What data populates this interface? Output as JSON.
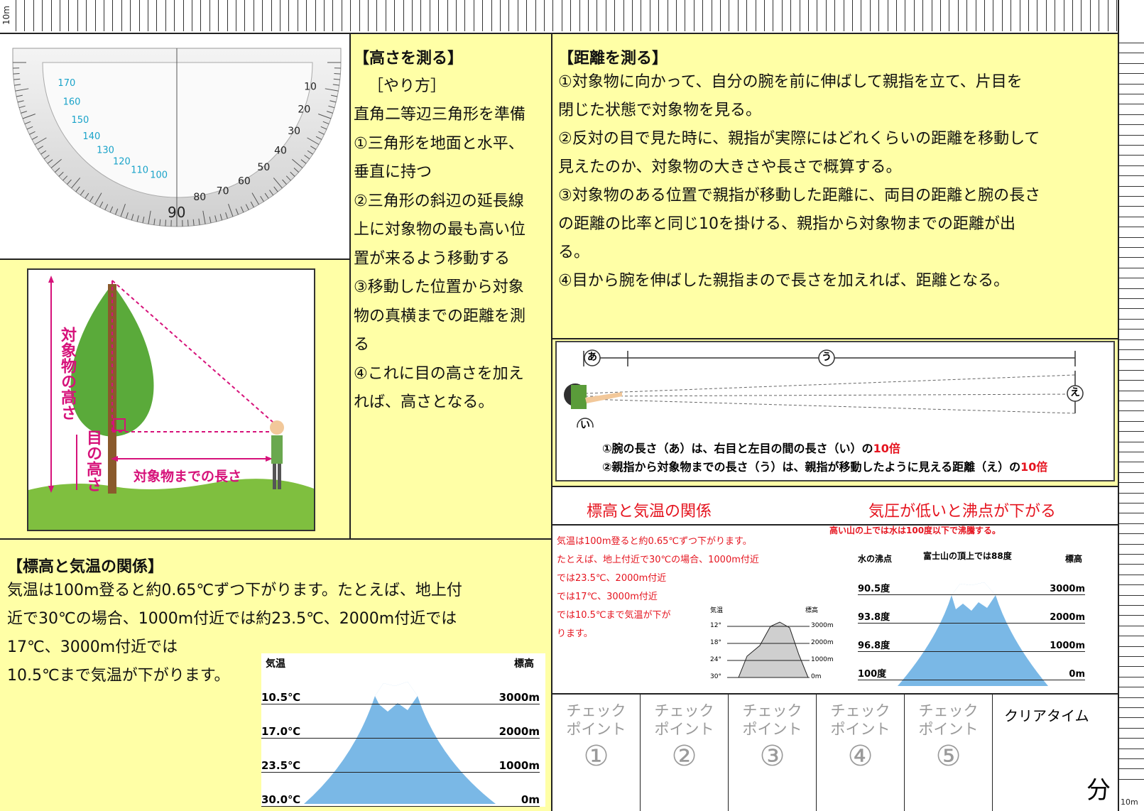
{
  "ruler": {
    "top_label": "10m",
    "corner_label": "10m"
  },
  "protractor": {
    "center_label": "90",
    "outer_left": [
      "10",
      "20",
      "30",
      "40",
      "50",
      "60",
      "70",
      "80"
    ],
    "outer_right": [
      "170",
      "160",
      "150",
      "140",
      "130",
      "120",
      "110",
      "100"
    ]
  },
  "height_section": {
    "title": "【高さを測る】",
    "subtitle": "［やり方］",
    "lines": [
      "直角二等辺三角形を準備",
      "①三角形を地面と水平、",
      "垂直に持つ",
      "②三角形の斜辺の延長線",
      "上に対象物の最も高い位",
      "置が来るよう移動する",
      "③移動した位置から対象",
      "物の真横までの距離を測",
      "る",
      "④これに目の高さを加え",
      "れば、高さとなる。"
    ]
  },
  "tree_diagram": {
    "label_object_height": "対象物の高さ",
    "label_eye_height": "目の高さ",
    "label_distance": "対象物までの長さ"
  },
  "distance_section": {
    "title": "【距離を測る】",
    "lines": [
      "①対象物に向かって、自分の腕を前に伸ばして親指を立て、片目を",
      "閉じた状態で対象物を見る。",
      "②反対の目で見た時に、親指が実際にはどれくらいの距離を移動して",
      "見えたのか、対象物の大きさや長さで概算する。",
      "③対象物のある位置で親指が移動した距離に、両目の距離と腕の長さ",
      "の距離の比率と同じ10を掛ける、親指から対象物までの距離が出",
      "る。",
      "④目から腕を伸ばした親指まので長さを加えれば、距離となる。"
    ]
  },
  "arm_diagram": {
    "label_a": "あ",
    "label_i": "い",
    "label_u": "う",
    "label_e": "え",
    "note1_prefix": "①腕の長さ（あ）は、右目と左目の間の長さ（い）の",
    "note1_suffix": "10倍",
    "note2_prefix": "②親指から対象物までの長さ（う）は、親指が移動したように見える距離（え）の",
    "note2_suffix": "10倍"
  },
  "headers": {
    "altitude_temp": "標高と気温の関係",
    "pressure_boil": "気圧が低いと沸点が下がる"
  },
  "altitude_text_panel": {
    "lines": [
      "気温は100m登ると約0.65℃ずつ下がります。",
      "たとえば、地上付近で30℃の場合、1000m付近",
      "では23.5℃、2000m付近",
      "では17℃、3000m付近",
      "では10.5℃まで気温が下が",
      "ります。"
    ],
    "chart_labels": {
      "left_header": "気温",
      "right_header": "標高",
      "temps": [
        "12°",
        "18°",
        "24°",
        "30°"
      ],
      "heights": [
        "3000m",
        "2000m",
        "1000m",
        "0m"
      ]
    }
  },
  "boiling_panel": {
    "note": "高い山の上では水は100度以下で沸騰する。",
    "left_header": "水の沸点",
    "top_label": "富士山の頂上では88度",
    "right_header": "標高",
    "rows": [
      {
        "left": "90.5度",
        "right": "3000m"
      },
      {
        "left": "93.8度",
        "right": "2000m"
      },
      {
        "left": "96.8度",
        "right": "1000m"
      },
      {
        "left": "100度",
        "right": "0m"
      }
    ]
  },
  "altitude_section": {
    "title": "【標高と気温の関係】",
    "lines": [
      "気温は100m登ると約0.65℃ずつ下がります。たとえば、地上付",
      "近で30℃の場合、1000m付近では約23.5℃、2000m付近では",
      "17℃、3000m付近では",
      "10.5℃まで気温が下がります。"
    ],
    "chart": {
      "left_header": "気温",
      "right_header": "標高",
      "rows": [
        {
          "left": "10.5℃",
          "right": "3000m"
        },
        {
          "left": "17.0℃",
          "right": "2000m"
        },
        {
          "left": "23.5℃",
          "right": "1000m"
        },
        {
          "left": "30.0℃",
          "right": "0m"
        }
      ]
    }
  },
  "checkpoints": {
    "label_line1": "チェック",
    "label_line2": "ポイント",
    "numbers": [
      "①",
      "②",
      "③",
      "④",
      "⑤"
    ],
    "clear_time_label": "クリアタイム",
    "minute_label": "分"
  },
  "colors": {
    "panel": "#ffffa6",
    "accent_red": "#e5141f",
    "accent_pink": "#d6127a",
    "mountain_blue": "#7ab8e6"
  }
}
